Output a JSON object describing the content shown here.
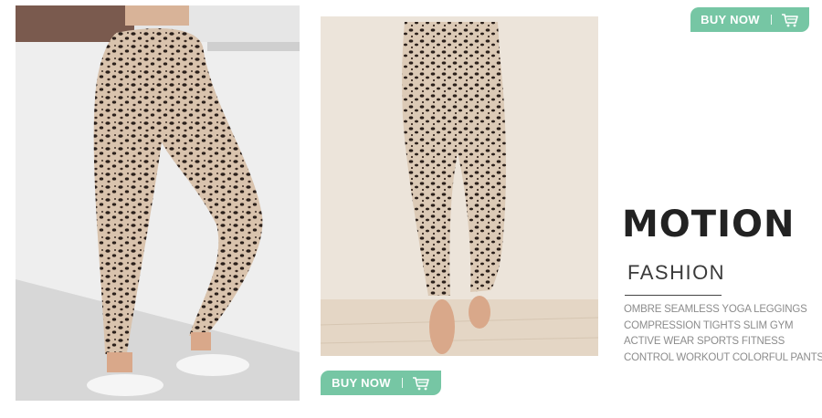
{
  "buttons": {
    "top_label": "BUY NOW",
    "bottom_label": "BUY NOW",
    "icon": "cart-icon"
  },
  "brand": {
    "title": "MOTION",
    "subtitle": "FASHION"
  },
  "description": {
    "lines": [
      "OMBRE SEAMLESS YOGA LEGGINGS",
      "COMPRESSION TIGHTS SLIM GYM",
      "ACTIVE WEAR SPORTS FITNESS",
      "CONTROL WORKOUT COLORFUL PANTS"
    ]
  },
  "colors": {
    "accent": "#76c6a4",
    "title": "#222222",
    "text_muted": "#8c8c8c"
  }
}
